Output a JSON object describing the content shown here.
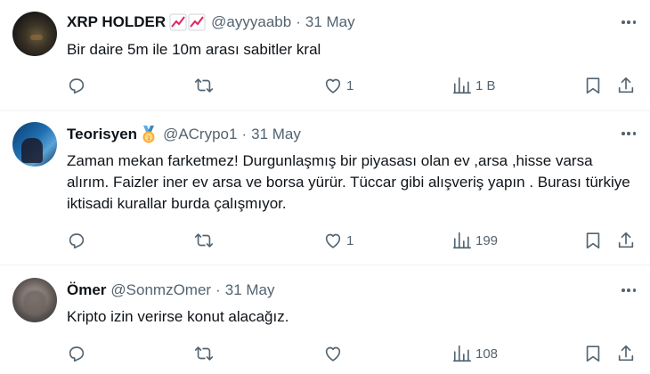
{
  "tweets": [
    {
      "name": "XRP HOLDER",
      "badge": "📈📈",
      "handle": "@ayyyaabb",
      "date": "31 May",
      "text": "Bir daire 5m ile 10m arası sabitler kral",
      "likes": "1",
      "views": "1 B",
      "avatar_icon": "avatar-dark-night-sky"
    },
    {
      "name": "Teorisyen",
      "badge": "🥇",
      "handle": "@ACrypo1",
      "date": "31 May",
      "text": "Zaman mekan farketmez! Durgunlaşmış bir piyasası olan ev ,arsa ,hisse varsa alırım. Faizler iner ev arsa ve borsa yürür. Tüccar gibi alışveriş yapın . Burası türkiye iktisadi kurallar burda çalışmıyor.",
      "likes": "1",
      "views": "199",
      "avatar_icon": "avatar-chart-screens"
    },
    {
      "name": "Ömer",
      "badge": "",
      "handle": "@SonmzOmer",
      "date": "31 May",
      "text": "Kripto izin verirse konut alacağız.",
      "likes": "",
      "views": "108",
      "avatar_icon": "avatar-blurred-face"
    }
  ],
  "colors": {
    "text": "#0f1419",
    "muted": "#536471",
    "divider": "#eff3f4",
    "chart_emoji": "#e0245e"
  },
  "icons": [
    "reply-icon",
    "retweet-icon",
    "heart-icon",
    "views-icon",
    "bookmark-icon",
    "share-icon",
    "more-options-icon"
  ]
}
